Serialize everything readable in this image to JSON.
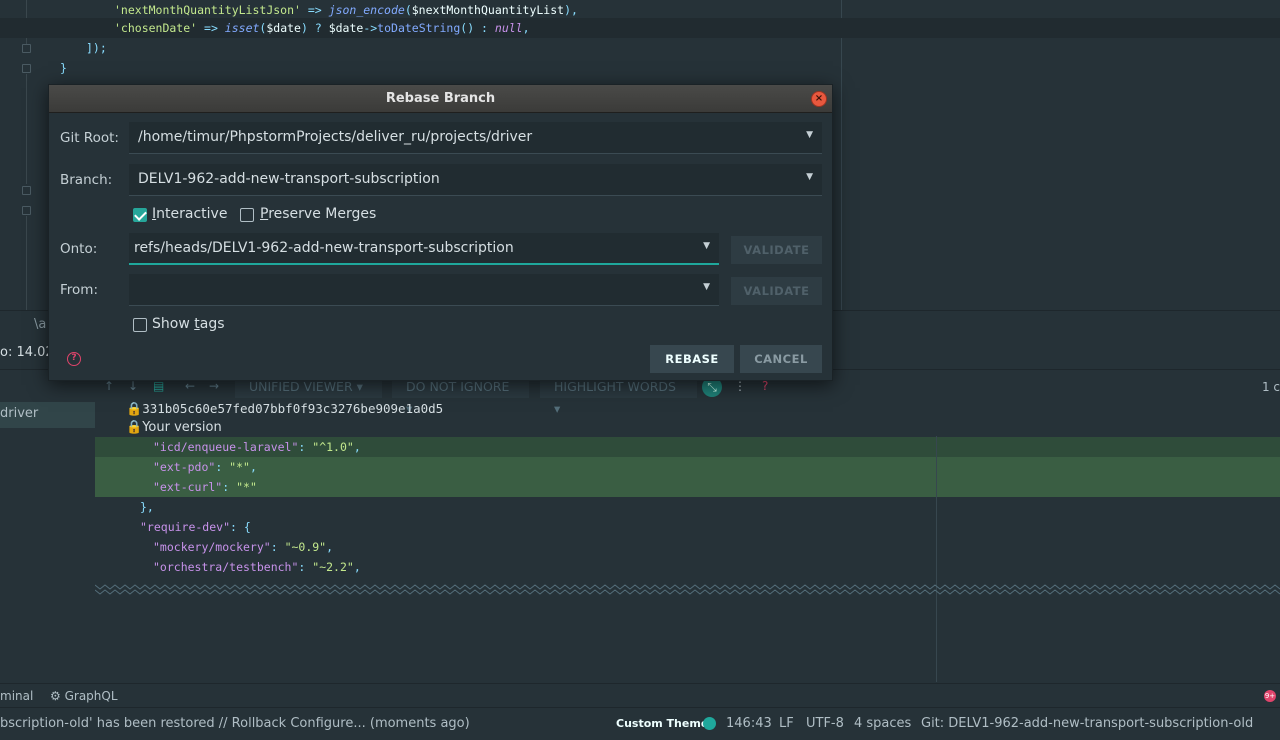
{
  "editor": {
    "lines": [
      {
        "parts": [
          [
            "s-str",
            "'nextMonthQuantityListJson'"
          ],
          [
            "s-punc",
            " => "
          ],
          [
            "s-fn",
            "json_encode"
          ],
          [
            "s-punc",
            "("
          ],
          [
            "s-var",
            "$nextMonthQuantityList"
          ],
          [
            "s-punc",
            "),"
          ]
        ]
      },
      {
        "parts": [
          [
            "s-str",
            "'chosenDate'"
          ],
          [
            "s-punc",
            " => "
          ],
          [
            "s-fn",
            "isset"
          ],
          [
            "s-punc",
            "("
          ],
          [
            "s-var",
            "$date"
          ],
          [
            "s-punc",
            ") ? "
          ],
          [
            "s-var",
            "$date"
          ],
          [
            "s-punc",
            "->"
          ],
          [
            "s-method",
            "toDateString"
          ],
          [
            "s-punc",
            "() : "
          ],
          [
            "s-kw",
            "null"
          ],
          [
            "s-punc",
            ","
          ]
        ]
      },
      {
        "parts": [
          [
            "s-punc",
            "]);"
          ]
        ]
      },
      {
        "parts": [
          [
            "s-punc",
            "}"
          ]
        ]
      }
    ]
  },
  "mid_strip": {
    "tab_text": "\\a",
    "info_text": "o: 14.02"
  },
  "left_panel": {
    "selected_item": "driver"
  },
  "diff": {
    "toolbar": {
      "viewer": "UNIFIED VIEWER",
      "ignore": "DO NOT IGNORE",
      "highlight": "HIGHLIGHT WORDS",
      "counter": "1 c"
    },
    "commit_hash": "331b05c60e57fed07bbf0f93c3276be909e1a0d5",
    "your_version": "Your version",
    "lines": [
      {
        "indent": "    ",
        "key": "\"icd/enqueue-laravel\"",
        "sep": ": ",
        "val": "\"^1.0\"",
        "end": ",",
        "style": "added"
      },
      {
        "indent": "    ",
        "key": "\"ext-pdo\"",
        "sep": ": ",
        "val": "\"*\"",
        "end": ",",
        "style": "added-strong"
      },
      {
        "indent": "    ",
        "key": "\"ext-curl\"",
        "sep": ": ",
        "val": "\"*\"",
        "end": "",
        "style": "added-strong"
      },
      {
        "indent": "  ",
        "key": "",
        "sep": "",
        "val": "",
        "end": "},",
        "style": ""
      },
      {
        "indent": "  ",
        "key": "\"require-dev\"",
        "sep": ": ",
        "val": "",
        "end": "{",
        "style": ""
      },
      {
        "indent": "    ",
        "key": "\"mockery/mockery\"",
        "sep": ": ",
        "val": "\"~0.9\"",
        "end": ",",
        "style": ""
      },
      {
        "indent": "    ",
        "key": "\"orchestra/testbench\"",
        "sep": ": ",
        "val": "\"~2.2\"",
        "end": ",",
        "style": ""
      }
    ]
  },
  "tool_strip": {
    "terminal": "minal",
    "graphql": "GraphQL"
  },
  "status_bar": {
    "message": "bscription-old' has been restored // Rollback  Configure... (moments ago)",
    "theme": "Custom Theme",
    "position": "146:43",
    "line_ending": "LF",
    "encoding": "UTF-8",
    "indent": "4 spaces",
    "branch": "Git: DELV1-962-add-new-transport-subscription-old"
  },
  "dialog": {
    "title": "Rebase Branch",
    "git_root_label": "Git Root:",
    "git_root_value": "/home/timur/PhpstormProjects/deliver_ru/projects/driver",
    "branch_label": "Branch:",
    "branch_value": "DELV1-962-add-new-transport-subscription",
    "interactive_label": "Interactive",
    "interactive_checked": true,
    "preserve_merges_label": "Preserve Merges",
    "preserve_merges_checked": false,
    "onto_label": "Onto:",
    "onto_value": "refs/heads/DELV1-962-add-new-transport-subscription",
    "from_label": "From:",
    "from_value": "",
    "validate_label": "VALIDATE",
    "show_tags_label": "Show tags",
    "show_tags_checked": false,
    "rebase_label": "REBASE",
    "cancel_label": "CANCEL"
  }
}
